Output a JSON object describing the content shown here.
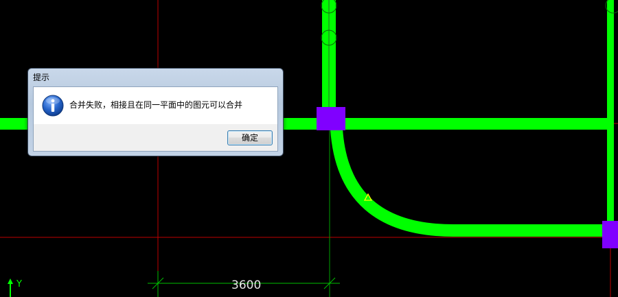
{
  "dialog": {
    "title": "提示",
    "message": "合并失败，相接且在同一平面中的图元可以合并",
    "ok_label": "确定",
    "icon": "info-icon"
  },
  "drawing": {
    "dimension_label": "3600",
    "axis_label": "Y",
    "colors": {
      "background": "#000000",
      "wall": "#00ff00",
      "column": "#8000ff",
      "grid_line": "#ff0000",
      "dimension_line": "#00c000"
    }
  }
}
